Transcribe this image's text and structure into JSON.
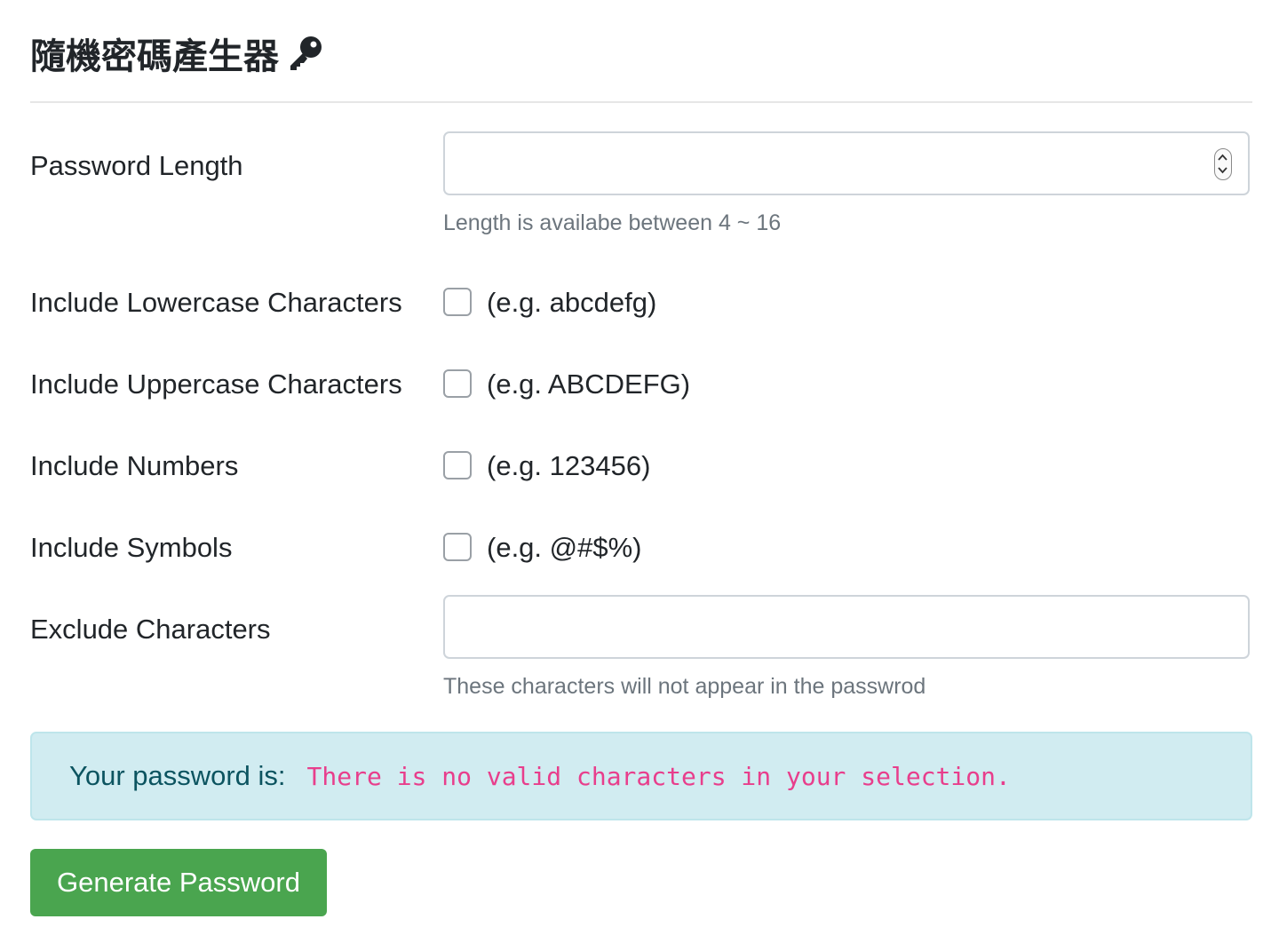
{
  "header": {
    "title": "隨機密碼產生器",
    "title_icon": "key-icon"
  },
  "form": {
    "length": {
      "label": "Password Length",
      "value": "",
      "help": "Length is availabe between 4 ~ 16"
    },
    "lowercase": {
      "label": "Include Lowercase Characters",
      "example": "(e.g. abcdefg)",
      "checked": false
    },
    "uppercase": {
      "label": "Include Uppercase Characters",
      "example": "(e.g. ABCDEFG)",
      "checked": false
    },
    "numbers": {
      "label": "Include Numbers",
      "example": "(e.g. 123456)",
      "checked": false
    },
    "symbols": {
      "label": "Include Symbols",
      "example": "(e.g. @#$%)",
      "checked": false
    },
    "exclude": {
      "label": "Exclude Characters",
      "value": "",
      "help": "These characters will not appear in the passwrod"
    }
  },
  "result": {
    "label": "Your password is:",
    "message": "There is no valid characters in your selection."
  },
  "actions": {
    "generate_label": "Generate Password"
  },
  "colors": {
    "alert_bg": "#d1ecf1",
    "alert_text": "#0c5460",
    "code_text": "#e83e8c",
    "button_bg": "#4aa54f"
  }
}
